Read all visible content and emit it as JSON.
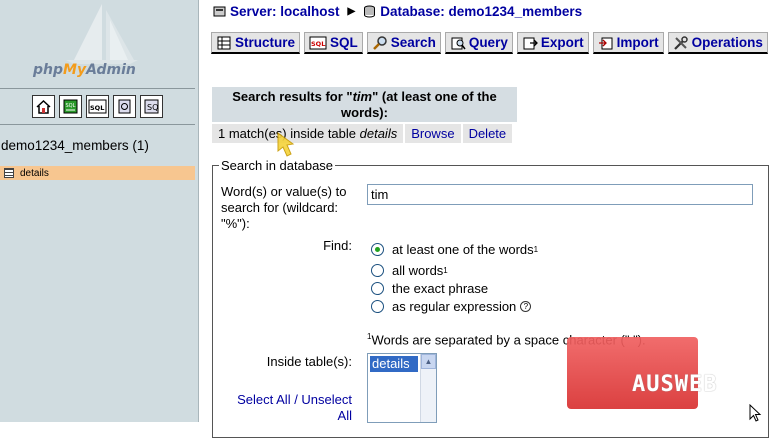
{
  "sidebar": {
    "logo": "phpMyAdmin",
    "quick_icons": [
      "home-icon",
      "sql-query-icon",
      "sql-window-icon",
      "docs-icon",
      "help-icon"
    ],
    "database_label": "demo1234_members (1)",
    "tables": [
      {
        "name": "details",
        "icon": "table-icon"
      }
    ],
    "selected_color": "#f7c690"
  },
  "breadcrumb": {
    "server": "Server: localhost",
    "database": "Database: demo1234_members"
  },
  "tabs": [
    {
      "label": "Structure",
      "icon": "structure-icon"
    },
    {
      "label": "SQL",
      "icon": "sql-icon"
    },
    {
      "label": "Search",
      "icon": "search-icon"
    },
    {
      "label": "Query",
      "icon": "query-icon"
    },
    {
      "label": "Export",
      "icon": "export-icon"
    },
    {
      "label": "Import",
      "icon": "import-icon"
    },
    {
      "label": "Operations",
      "icon": "operations-icon"
    }
  ],
  "results": {
    "title_prefix": "Search results for \"",
    "title_term": "tim",
    "title_suffix": "\" (at least one of the words):",
    "match_text": "1 match(es) inside table ",
    "match_table": "details",
    "browse": "Browse",
    "delete": "Delete"
  },
  "search_form": {
    "legend": "Search in database",
    "words_label": "Word(s) or value(s) to search for (wildcard: \"%\"):",
    "words_value": "tim",
    "find_label": "Find:",
    "options": [
      {
        "label": "at least one of the words",
        "sup": "1",
        "checked": true
      },
      {
        "label": "all words",
        "sup": "1",
        "checked": false
      },
      {
        "label": "the exact phrase",
        "sup": "",
        "checked": false
      },
      {
        "label": "as regular expression",
        "sup": "",
        "checked": false
      }
    ],
    "note_sup": "1",
    "note": "Words are separated by a space character (\" \").",
    "tables_label": "Inside table(s):",
    "table_option": "details",
    "select_all": "Select All / Unselect All"
  },
  "watermark": "AUSWEB",
  "colors": {
    "sidebar_bg": "#d0dce0",
    "link": "#0000a0",
    "tab_bg": "#e5e5e5",
    "result_header_bg": "#d5dde2",
    "watermark": "#e04040"
  }
}
